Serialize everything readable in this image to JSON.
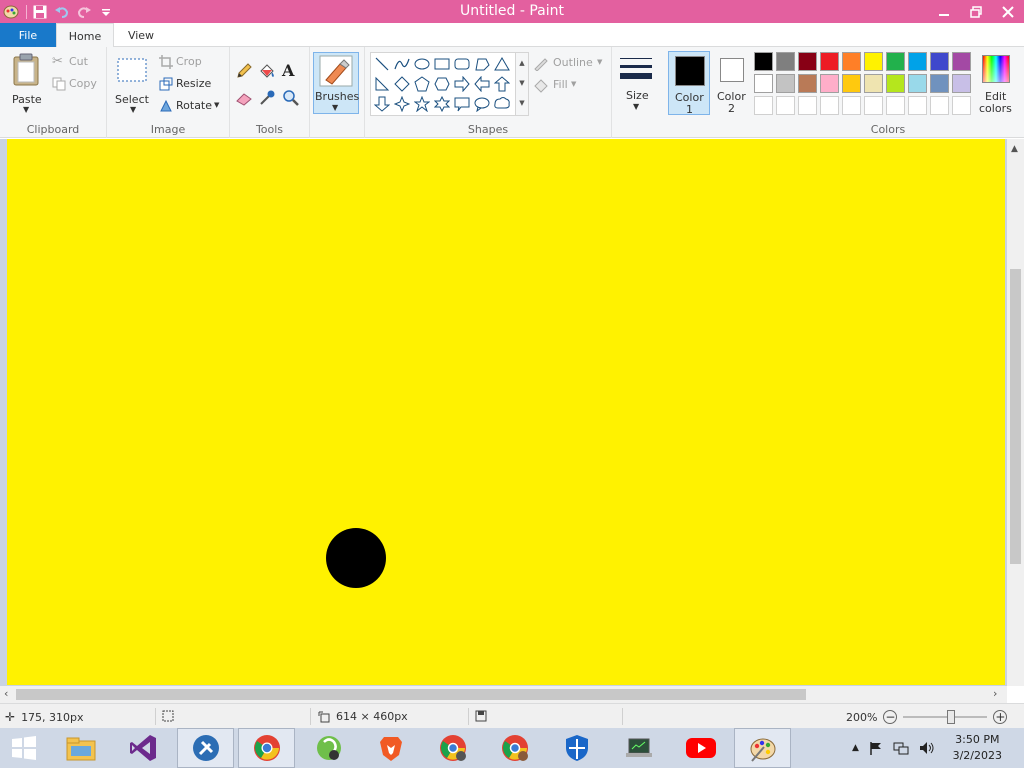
{
  "window": {
    "title": "Untitled - Paint"
  },
  "qat": {
    "icons": [
      "paint-app-icon",
      "save-icon",
      "undo-icon",
      "redo-icon",
      "customize-icon"
    ]
  },
  "tabs": {
    "file": "File",
    "home": "Home",
    "view": "View"
  },
  "ribbon": {
    "clipboard": {
      "label": "Clipboard",
      "paste": "Paste",
      "cut": "Cut",
      "copy": "Copy"
    },
    "image": {
      "label": "Image",
      "select": "Select",
      "crop": "Crop",
      "resize": "Resize",
      "rotate": "Rotate"
    },
    "tools": {
      "label": "Tools"
    },
    "brushes": {
      "label": "Brushes"
    },
    "shapes": {
      "label": "Shapes",
      "outline": "Outline",
      "fill": "Fill"
    },
    "size": {
      "label": "Size"
    },
    "color1": {
      "line1": "Color",
      "line2": "1",
      "value": "#000000"
    },
    "color2": {
      "line1": "Color",
      "line2": "2",
      "value": "#ffffff"
    },
    "colors": {
      "label": "Colors",
      "edit_line1": "Edit",
      "edit_line2": "colors",
      "row1": [
        "#000000",
        "#7f7f7f",
        "#880015",
        "#ed1c24",
        "#ff7f27",
        "#fff200",
        "#22b14c",
        "#00a2e8",
        "#3f48cc",
        "#a349a4"
      ],
      "row2": [
        "#ffffff",
        "#c3c3c3",
        "#b97a57",
        "#ffaec9",
        "#ffc90e",
        "#efe4b0",
        "#b5e61d",
        "#99d9ea",
        "#7092be",
        "#c8bfe7"
      ],
      "row3": [
        "#ffffff",
        "#ffffff",
        "#ffffff",
        "#ffffff",
        "#ffffff",
        "#ffffff",
        "#ffffff",
        "#ffffff",
        "#ffffff",
        "#ffffff"
      ]
    }
  },
  "canvas": {
    "background": "#fff200",
    "dot_color": "#000000"
  },
  "status": {
    "cursor_pos": "175, 310px",
    "canvas_size": "614 × 460px",
    "zoom": "200%"
  },
  "taskbar": {
    "apps": [
      "windows-start-icon",
      "file-explorer-icon",
      "visual-studio-icon",
      "tools-app-icon",
      "chrome-icon",
      "app-icon",
      "brave-icon",
      "chrome-profile-icon",
      "chrome-profile2-icon",
      "defender-icon",
      "laptop-app-icon",
      "youtube-icon",
      "paint-icon"
    ],
    "time": "3:50 PM",
    "date": "3/2/2023"
  }
}
